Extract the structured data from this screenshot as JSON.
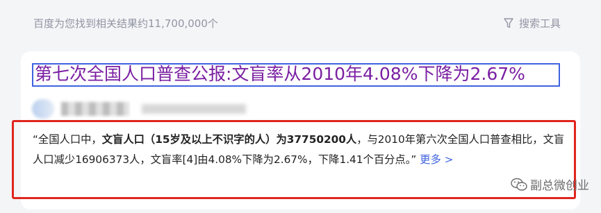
{
  "header": {
    "result_count": "百度为您找到相关结果约11,700,000个",
    "tools_label": "搜索工具",
    "tools_icon": "filter-icon"
  },
  "result": {
    "title": "第七次全国人口普查公报:文盲率从2010年4.08%下降为2.67%",
    "site_logo_icon": "site-logo",
    "snippet": {
      "part1": "“全国人口中，",
      "bold": "文盲人口（15岁及以上不识字的人）为37750200人",
      "part2": "，与2010年第六次全国人口普查相比，文盲人口减少16906373人，文盲率[4]由4.08%下降为2.67%，下降1.41个百分点。”",
      "more": "更多 >"
    }
  },
  "watermark": {
    "text": "副总微创业",
    "icon": "wechat-icon"
  },
  "colors": {
    "title": "#7a1fa2",
    "link": "#3e63e0",
    "highlight_border": "#e0251e",
    "muted_text": "#9195a3"
  }
}
